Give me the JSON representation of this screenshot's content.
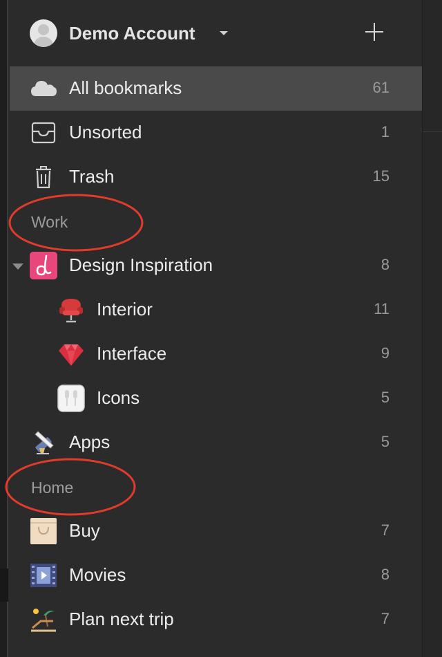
{
  "header": {
    "account_name": "Demo Account"
  },
  "system": [
    {
      "label": "All bookmarks",
      "count": "61",
      "icon": "cloud-icon"
    },
    {
      "label": "Unsorted",
      "count": "1",
      "icon": "inbox-tray-icon"
    },
    {
      "label": "Trash",
      "count": "15",
      "icon": "trash-icon"
    }
  ],
  "groups": [
    {
      "title": "Work",
      "items": [
        {
          "label": "Design Inspiration",
          "count": "8",
          "icon": "dribbble-logo-icon"
        },
        {
          "label": "Interior",
          "count": "11",
          "icon": "red-chair-icon"
        },
        {
          "label": "Interface",
          "count": "9",
          "icon": "ruby-gem-icon"
        },
        {
          "label": "Icons",
          "count": "5",
          "icon": "earphones-box-icon"
        },
        {
          "label": "Apps",
          "count": "5",
          "icon": "pen-tools-icon"
        }
      ]
    },
    {
      "title": "Home",
      "items": [
        {
          "label": "Buy",
          "count": "7",
          "icon": "shopping-bag-icon"
        },
        {
          "label": "Movies",
          "count": "8",
          "icon": "film-strip-icon"
        },
        {
          "label": "Plan next trip",
          "count": "7",
          "icon": "beach-chair-icon"
        }
      ]
    }
  ],
  "colors": {
    "annotation": "#e23b2b",
    "selected_row": "#4a4a4a",
    "sidebar_bg": "#2b2b2b"
  }
}
